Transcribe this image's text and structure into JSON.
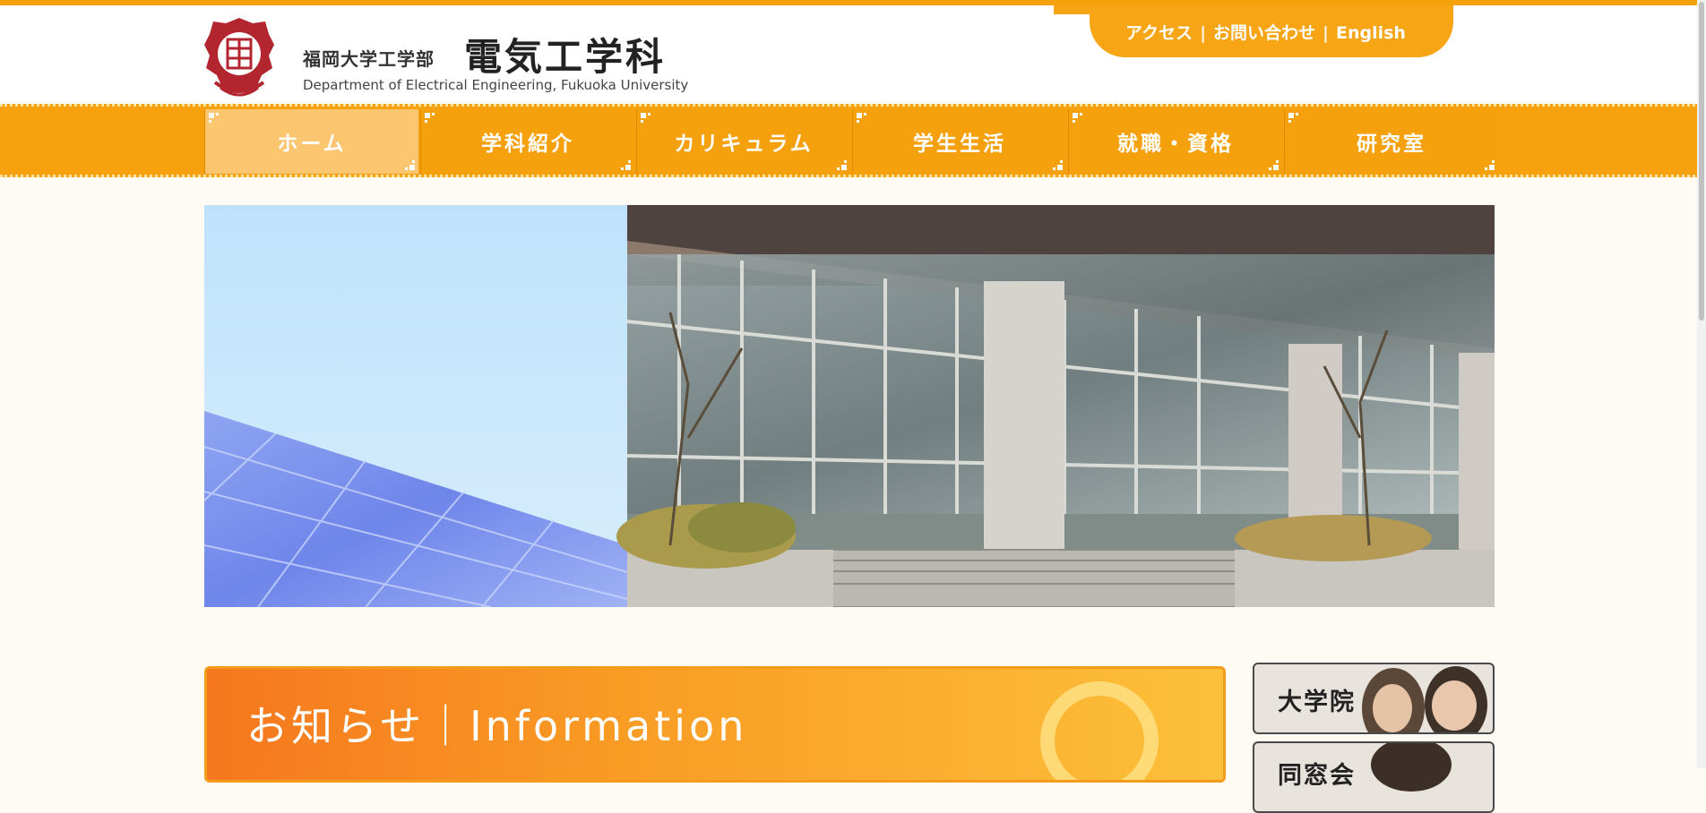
{
  "header": {
    "faculty": "福岡大学工学部",
    "department": "電気工学科",
    "department_en": "Department of Electrical Engineering, Fukuoka University",
    "logo_icon": "university-emblem-icon"
  },
  "utility_links": [
    {
      "label": "アクセス"
    },
    {
      "label": "お問い合わせ"
    },
    {
      "label": "English"
    }
  ],
  "utility_separator": "|",
  "nav": {
    "items": [
      {
        "label": "ホーム",
        "active": true
      },
      {
        "label": "学科紹介",
        "active": false
      },
      {
        "label": "カリキュラム",
        "active": false
      },
      {
        "label": "学生生活",
        "active": false
      },
      {
        "label": "就職・資格",
        "active": false
      },
      {
        "label": "研究室",
        "active": false
      }
    ]
  },
  "hero": {
    "icons": [
      "solar-panel-image",
      "building-entrance-image"
    ]
  },
  "info": {
    "title": "お知らせ｜Information"
  },
  "side_banners": [
    {
      "label": "大学院"
    },
    {
      "label": "同窓会"
    }
  ],
  "colors": {
    "accent": "#f8a10f",
    "nav_active": "#fcc56f",
    "info_gradient_start": "#f6771e",
    "info_gradient_end": "#fcc03a"
  }
}
